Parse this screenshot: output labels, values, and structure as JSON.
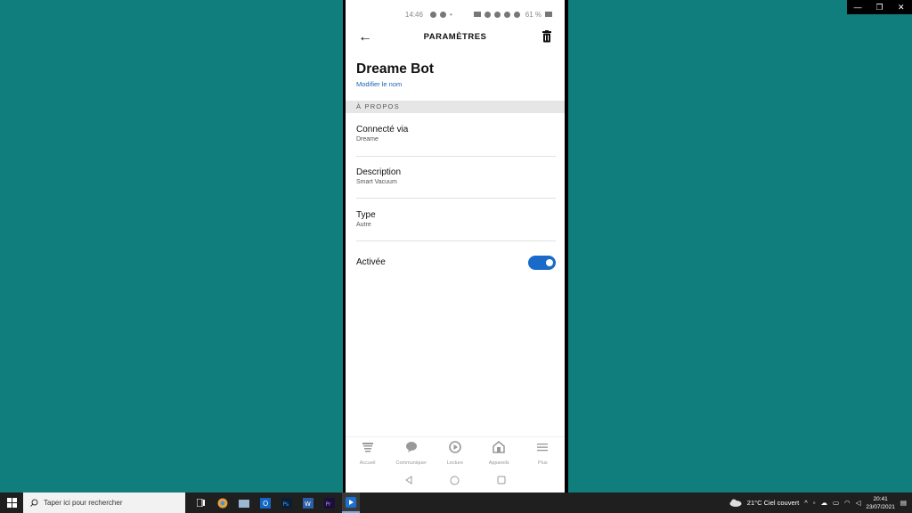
{
  "window": {
    "controls": [
      "—",
      "❐",
      "✕"
    ]
  },
  "phone": {
    "status_bar": {
      "time": "14:46",
      "battery": "61 %"
    },
    "appbar": {
      "title": "PARAMÈTRES"
    },
    "device": {
      "name": "Dreame Bot",
      "rename_link": "Modifier le nom"
    },
    "section": {
      "label": "À PROPOS"
    },
    "rows": [
      {
        "title": "Connecté via",
        "value": "Dreame"
      },
      {
        "title": "Description",
        "value": "Smart Vacuum"
      },
      {
        "title": "Type",
        "value": "Autre"
      }
    ],
    "toggle": {
      "label": "Activée",
      "enabled": true
    },
    "bottom_nav": [
      {
        "label": "Accueil",
        "icon": "home-icon"
      },
      {
        "label": "Communiquer",
        "icon": "chat-icon"
      },
      {
        "label": "Lecture",
        "icon": "play-icon"
      },
      {
        "label": "Appareils",
        "icon": "devices-icon"
      },
      {
        "label": "Plus",
        "icon": "menu-icon"
      }
    ]
  },
  "taskbar": {
    "search_placeholder": "Taper ici pour rechercher",
    "weather": "21°C  Ciel couvert",
    "time": "20:41",
    "date": "23/07/2021"
  },
  "colors": {
    "accent": "#1a6bc9",
    "desktop": "#0f7e7d",
    "link": "#1b63b5"
  }
}
